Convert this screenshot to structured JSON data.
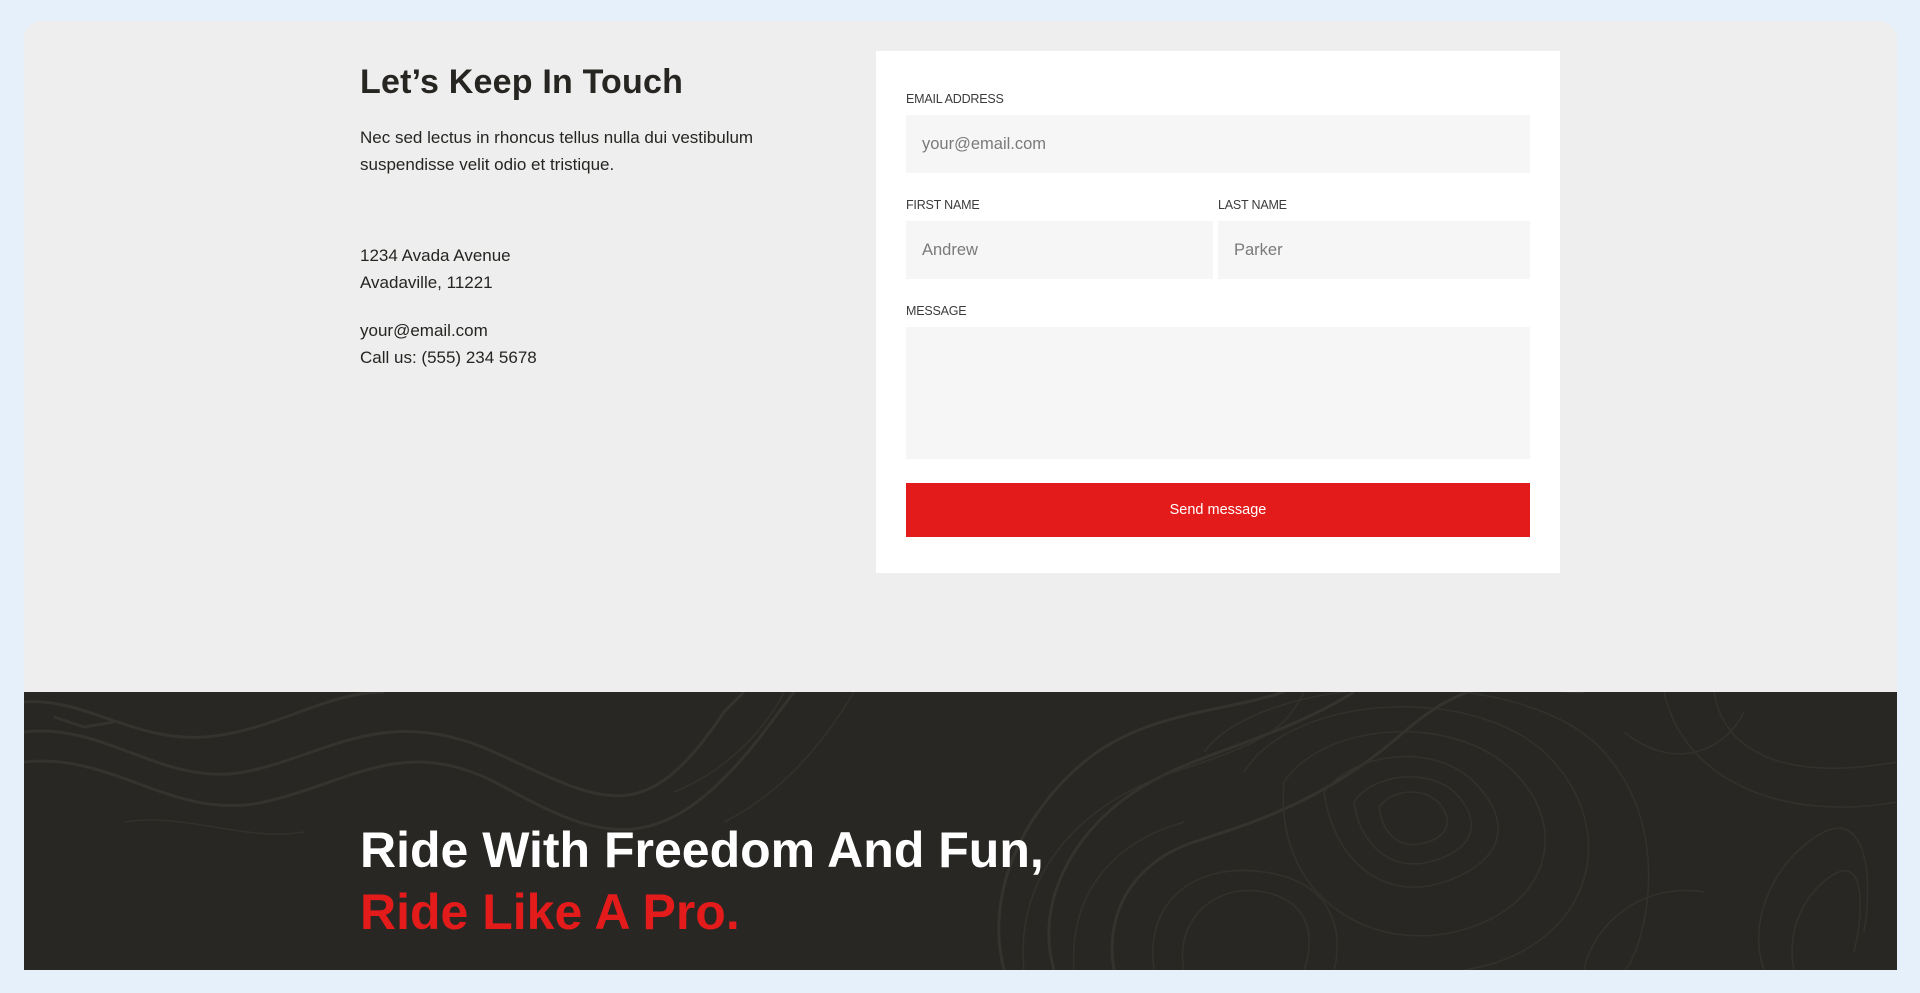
{
  "contact": {
    "title": "Let’s Keep In Touch",
    "lead": "Nec sed lectus in rhoncus tellus nulla dui vestibulum suspendisse velit odio et tristique.",
    "address_line1": "1234 Avada Avenue",
    "address_line2": "Avadaville, 11221",
    "email": "your@email.com",
    "phone": "Call us: (555) 234 5678"
  },
  "form": {
    "email_label": "EMAIL ADDRESS",
    "email_placeholder": "your@email.com",
    "first_name_label": "FIRST NAME",
    "first_name_placeholder": "Andrew",
    "last_name_label": "LAST NAME",
    "last_name_placeholder": "Parker",
    "message_label": "MESSAGE",
    "message_placeholder": "",
    "submit_label": "Send message"
  },
  "banner": {
    "line1": "Ride With Freedom And Fun,",
    "line2": "Ride Like A Pro."
  },
  "colors": {
    "accent": "#e41b1b",
    "dark": "#282723",
    "section_bg": "#eeeeee",
    "input_bg": "#f6f6f6"
  }
}
